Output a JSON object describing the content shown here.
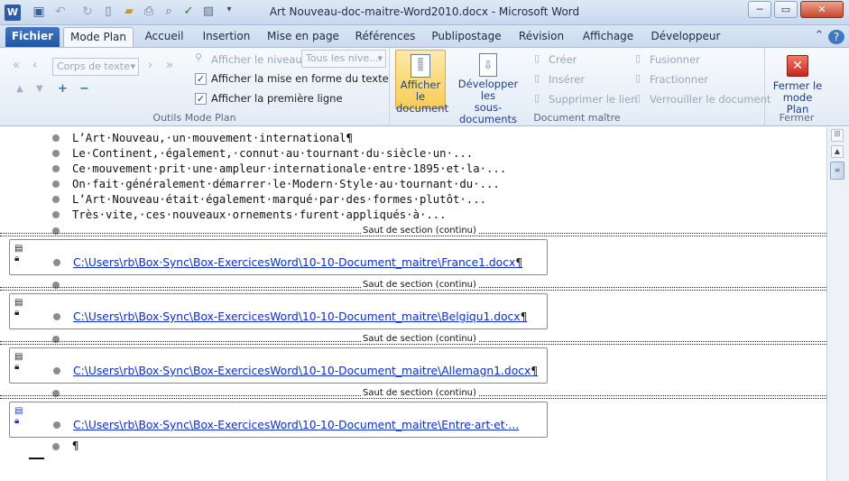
{
  "window": {
    "title": "Art Nouveau-doc-maitre-Word2010.docx  -  Microsoft Word",
    "controls": {
      "minimize": "─",
      "maximize": "▭",
      "close": "✕"
    }
  },
  "quick_access": [
    "word-icon",
    "save-icon",
    "undo-icon",
    "redo-icon",
    "new-icon",
    "open-icon",
    "print-icon",
    "print-preview-icon",
    "spelling-icon",
    "format-icon",
    "customize-icon"
  ],
  "tabs": [
    "Fichier",
    "Mode Plan",
    "Accueil",
    "Insertion",
    "Mise en page",
    "Références",
    "Publipostage",
    "Révision",
    "Affichage",
    "Développeur"
  ],
  "active_tab": "Mode Plan",
  "ribbon": {
    "outline_tools": {
      "label": "Outils Mode Plan",
      "level_combo": "Corps de texte",
      "show_level_label": "Afficher le niveau :",
      "show_level_value": "Tous les nive...",
      "show_formatting": {
        "label": "Afficher la mise en forme du texte",
        "checked": true
      },
      "show_first_line": {
        "label": "Afficher la première ligne",
        "checked": true
      }
    },
    "master_document": {
      "label": "Document maître",
      "show_document": "Afficher le document",
      "show_document_line1": "Afficher le",
      "show_document_line2": "document",
      "expand_line1": "Développer les",
      "expand_line2": "sous-documents",
      "create": "Créer",
      "insert": "Insérer",
      "unlink": "Supprimer le lien",
      "merge": "Fusionner",
      "split": "Fractionner",
      "lock": "Verrouiller le document"
    },
    "close": {
      "label": "Fermer",
      "button_line1": "Fermer le",
      "button_line2": "mode Plan"
    }
  },
  "document": {
    "paragraphs": [
      "L’Art·Nouveau,·un·mouvement·international¶",
      "Le·Continent,·également,·connut·au·tournant·du·siècle·un·...",
      "Ce·mouvement·prit·une·ampleur·internationale·entre·1895·et·la·...",
      "On·fait·généralement·démarrer·le·Modern·Style·au·tournant·du·...",
      "L’Art·Nouveau·était·également·marqué·par·des·formes·plutôt·...",
      "Très·vite,·ces·nouveaux·ornements·furent·appliqués·à·..."
    ],
    "section_break": "Saut de section (continu)",
    "subdocuments": [
      {
        "path": "C:\\Users\\rb\\Box·Sync\\Box-ExercicesWord\\10-10-Document_maitre\\France1.docx",
        "mark": "¶"
      },
      {
        "path": "C:\\Users\\rb\\Box·Sync\\Box-ExercicesWord\\10-10-Document_maitre\\Belgiqu1.docx",
        "mark": "¶"
      },
      {
        "path": "C:\\Users\\rb\\Box·Sync\\Box-ExercicesWord\\10-10-Document_maitre\\Allemagn1.docx",
        "mark": "¶"
      },
      {
        "path": "C:\\Users\\rb\\Box·Sync\\Box-ExercicesWord\\10-10-Document_maitre\\Entre·art·et·...",
        "mark": ""
      }
    ],
    "last_paragraph": "¶"
  },
  "colors": {
    "link": "#0b2fd0",
    "active_button": "#fbd86a",
    "fichier_tab": "#2b62ae"
  }
}
